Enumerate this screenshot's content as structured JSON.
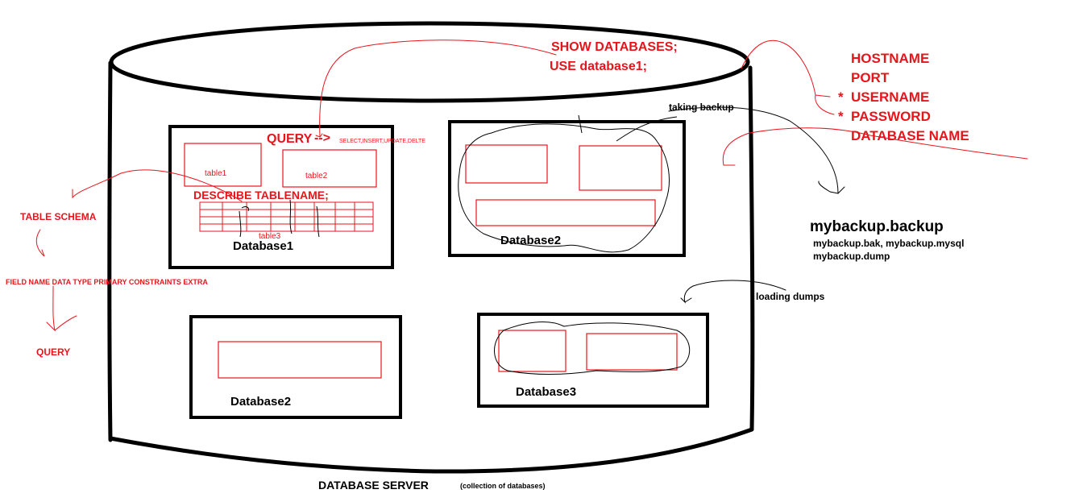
{
  "colors": {
    "red": "#e8141c",
    "black": "#000000",
    "background": "#ffffff"
  },
  "server": {
    "title": "DATABASE SERVER",
    "subtitle": "(collection of databases)"
  },
  "top_commands": {
    "line1": "SHOW DATABASES;",
    "line2": "USE database1;"
  },
  "connection_params": {
    "hostname": "HOSTNAME",
    "port": "PORT",
    "username": "USERNAME",
    "password": "PASSWORD",
    "database_name": "DATABASE NAME",
    "star1": "*",
    "star2": "*"
  },
  "databases": {
    "db1": {
      "label": "Database1",
      "table1": "table1",
      "table2": "table2",
      "table3": "table3",
      "query_label": "QUERY",
      "query_arrow": "-->",
      "query_ops": "SELECT,INSERT,UPDATE,DELTE",
      "describe": "DESCRIBE TABLENAME;"
    },
    "db2_top": {
      "label": "Database2"
    },
    "db2_bottom": {
      "label": "Database2"
    },
    "db3": {
      "label": "Database3"
    }
  },
  "schema": {
    "title": "TABLE SCHEMA",
    "fields": "FIELD NAME DATA TYPE PRIMARY CONSTRAINTS EXTRA",
    "query": "QUERY"
  },
  "backup": {
    "taking": "taking backup",
    "filename": "mybackup.backup",
    "alt1": "mybackup.bak, mybackup.mysql",
    "alt2": "mybackup.dump",
    "loading": "loading dumps"
  }
}
